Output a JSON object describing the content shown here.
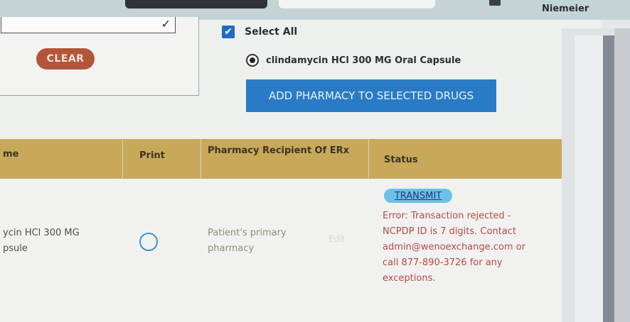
{
  "header": {
    "user_name": "Niemeier"
  },
  "search": {
    "clear_label": "CLEAR"
  },
  "selection": {
    "select_all_label": "Select All",
    "select_all_checked": true,
    "drug_option_label": "clindamycin HCl 300 MG Oral Capsule",
    "drug_option_selected": true,
    "add_pharmacy_label": "ADD PHARMACY TO SELECTED DRUGS"
  },
  "table": {
    "columns": [
      "me",
      "Print",
      "Pharmacy Recipient Of ERx",
      "Status"
    ],
    "rows": [
      {
        "drug_line1": "ycin HCl 300 MG",
        "drug_line2": "psule",
        "print_selected": false,
        "pharmacy_line1": "Patient's primary",
        "pharmacy_line2": "pharmacy",
        "edit_label": "Edit",
        "transmit_label": "TRANSMIT",
        "status_line1": "Error: Transaction rejected -",
        "status_line2": "NCPDP ID is 7 digits. Contact",
        "status_line3": "admin@wenoexchange.com or",
        "status_line4": "call 877-890-3726 for any",
        "status_line5": "exceptions."
      }
    ]
  },
  "colors": {
    "clear_button": "#b4553a",
    "table_header": "#c8a95a",
    "primary_button": "#2a7bc6",
    "transmit_pill": "#6cc0e8",
    "error_text": "#b24a4a"
  }
}
